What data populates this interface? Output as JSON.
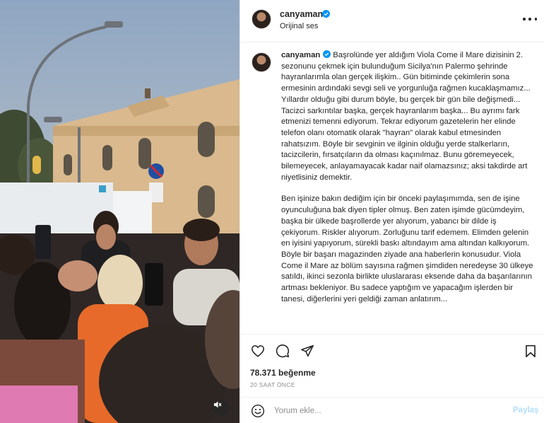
{
  "post": {
    "username": "canyaman",
    "audio": "Orijinal ses",
    "caption_paragraphs": [
      "Başrolünde yer aldığım Viola Come il Mare dizisinin 2. sezonunu çekmek için bulunduğum Sicilya'nın Palermo şehrinde hayranlarımla olan gerçek ilişkim.. Gün bitiminde çekimlerin sona ermesinin ardındaki sevgi seli ve yorgunluğa rağmen kucaklaşmamız... Yıllardır olduğu gibi durum böyle, bu gerçek bir gün bile değişmedi... Tacizci sarkıntılar başka, gerçek hayranlarım başka... Bu ayrımı fark etmenizi temenni ediyorum. Tekrar ediyorum gazetelerin her elinde telefon olanı otomatik olarak \"hayran\" olarak kabul etmesinden rahatsızım. Böyle bir sevginin ve ilginin olduğu yerde stalkerların, tacizcilerin, fırsatçıların da olması kaçınılmaz. Bunu göremeyecek, bilemeyecek, anlayamayacak kadar naif olamazsınız; aksi takdirde art niyetlisiniz demektir.",
      "Ben işinize bakın dediğim için bir önceki paylaşımımda, sen de işine oyunculuğuna bak diyen tipler olmuş. Ben zaten işimde gücümdeyim, başka bir ülkede başrollerde yer alıyorum, yabancı bir dilde iş çekiyorum. Riskler alıyorum. Zorluğunu tarif edemem. Elimden gelenin en iyisini yapıyorum, sürekli baskı altındayım ama altından kalkıyorum. Böyle bir başarı magazinden ziyade ana haberlerin konusudur. Viola Come il Mare az bölüm sayısına rağmen şimdiden neredeyse 30 ülkeye satıldı, ikinci sezonla birlikte uluslararası eksende daha da başarılarının artması bekleniyor. Bu sadece yaptığım ve yapacağım işlerden bir tanesi, diğerlerini yeri geldiği zaman anlatırım..."
    ],
    "likes": "78.371 beğenme",
    "time_ago": "20 SAAT ÖNCE"
  },
  "comment": {
    "placeholder": "Yorum ekle...",
    "post_label": "Paylaş"
  },
  "icons": {
    "verified": "verified-badge-icon",
    "more": "more-options-icon",
    "like": "heart-icon",
    "comment": "comment-icon",
    "share": "share-icon",
    "save": "bookmark-icon",
    "emoji": "emoji-icon",
    "mute": "muted-speaker-icon"
  },
  "colors": {
    "verified": "#0095f6",
    "post_disabled": "#b2dffc",
    "muted_text": "#8e8e8e"
  }
}
